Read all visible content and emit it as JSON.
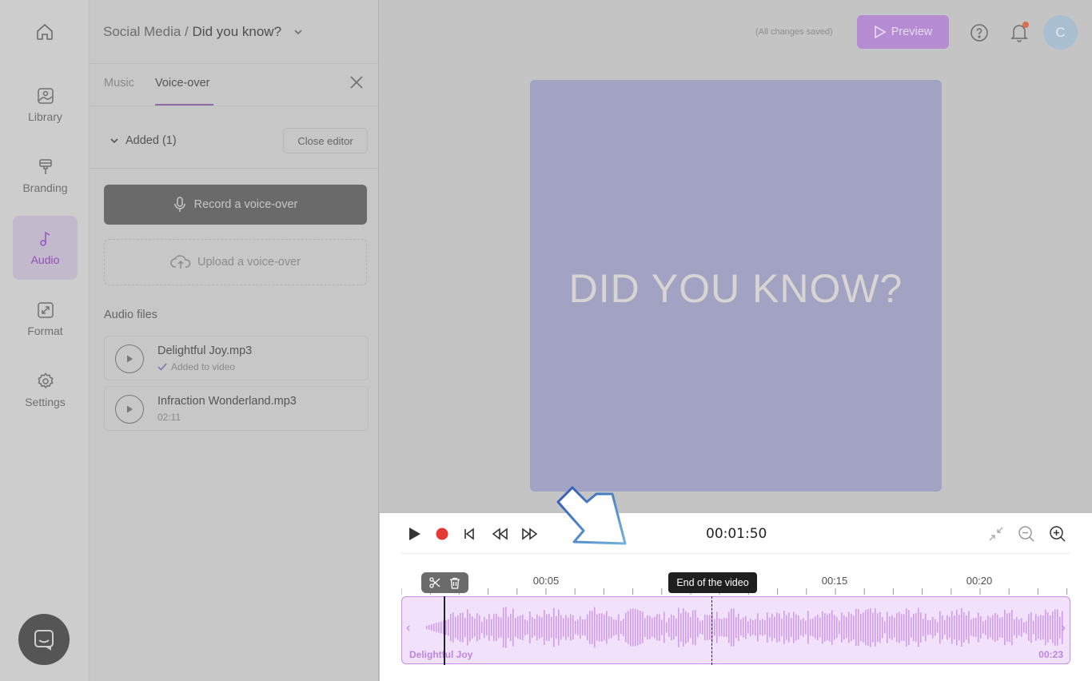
{
  "project": {
    "breadcrumb_parent": "Social Media /",
    "breadcrumb_current": "Did you know?"
  },
  "rail": {
    "items": [
      {
        "label": "Library",
        "icon": "image-icon"
      },
      {
        "label": "Branding",
        "icon": "paint-roller-icon"
      },
      {
        "label": "Audio",
        "icon": "music-note-icon",
        "active": true
      },
      {
        "label": "Format",
        "icon": "resize-icon"
      },
      {
        "label": "Settings",
        "icon": "gear-icon"
      }
    ]
  },
  "panel": {
    "tabs": [
      "Music",
      "Voice-over"
    ],
    "active_tab": "Voice-over",
    "added_label": "Added (1)",
    "close_editor": "Close editor",
    "record_label": "Record a voice-over",
    "upload_label": "Upload a voice-over",
    "files_title": "Audio files",
    "files": [
      {
        "name": "Delightful Joy.mp3",
        "sub": "Added to video"
      },
      {
        "name": "Infraction Wonderland.mp3",
        "sub": "02:11"
      }
    ]
  },
  "header": {
    "saved_status": "(All changes saved)",
    "preview_label": "Preview",
    "avatar_initial": "C"
  },
  "canvas": {
    "text": "DID YOU KNOW?",
    "background": "#a2a2c3"
  },
  "timeline": {
    "timecode": "00:01:50",
    "ruler_labels": [
      "00:05",
      "00:15",
      "00:20"
    ],
    "tooltip": "End of the video",
    "track_name": "Delightful Joy",
    "track_duration": "00:23"
  },
  "colors": {
    "accent": "#b58cd2",
    "record": "#e53935",
    "track_fill": "#f1e1fb"
  }
}
